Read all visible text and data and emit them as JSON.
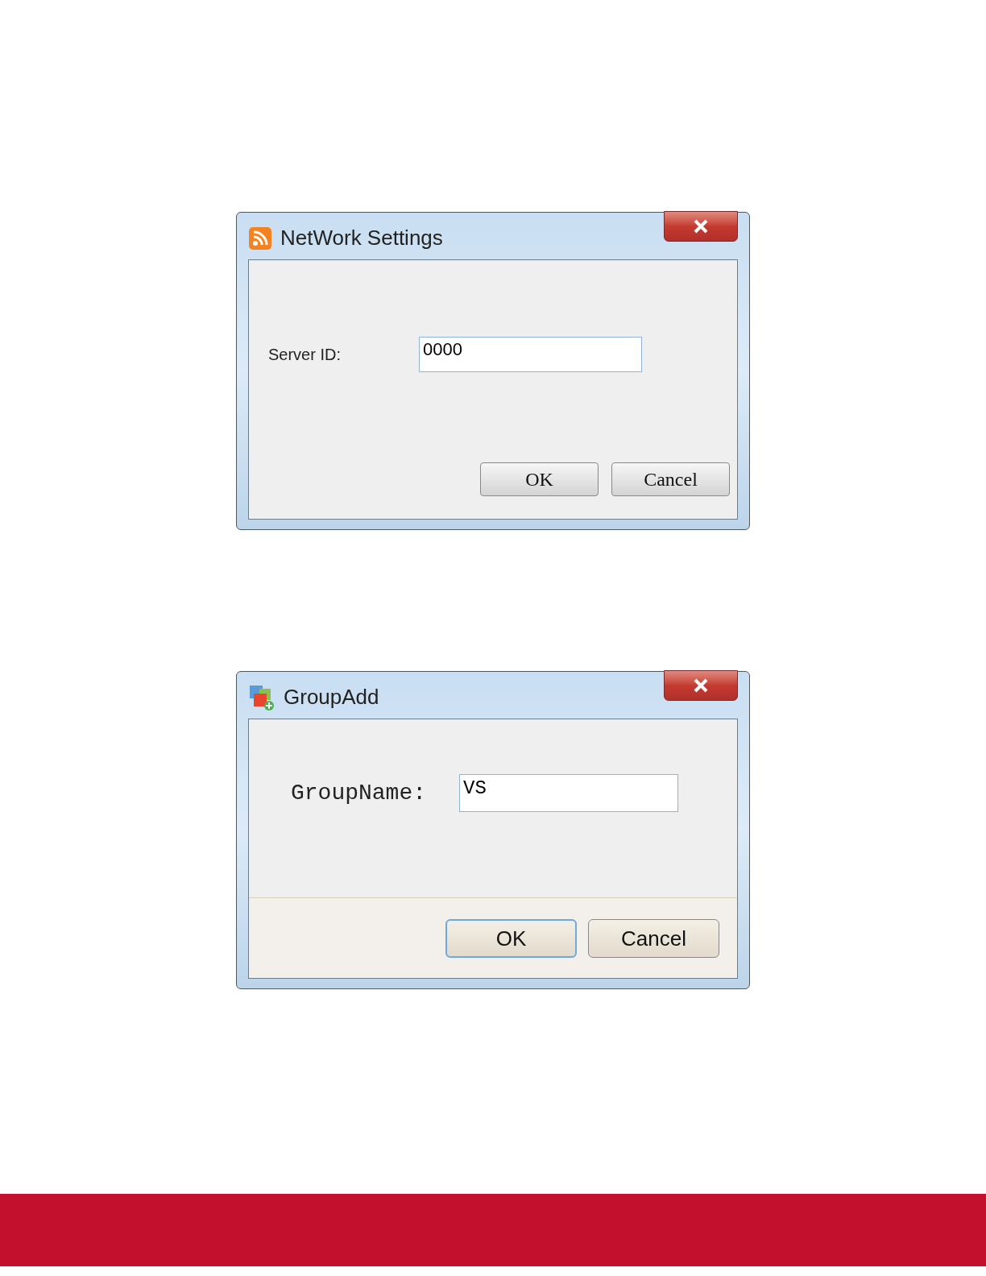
{
  "dialogs": [
    {
      "kind": "network",
      "title": "NetWork Settings",
      "field": {
        "label": "Server ID:",
        "value": "0000"
      },
      "buttons": [
        {
          "label": "OK",
          "focused": false
        },
        {
          "label": "Cancel",
          "focused": false
        }
      ]
    },
    {
      "kind": "group",
      "title": "GroupAdd",
      "field": {
        "label": "GroupName:",
        "value": "VS"
      },
      "buttons": [
        {
          "label": "OK",
          "focused": true
        },
        {
          "label": "Cancel",
          "focused": false
        }
      ]
    }
  ]
}
